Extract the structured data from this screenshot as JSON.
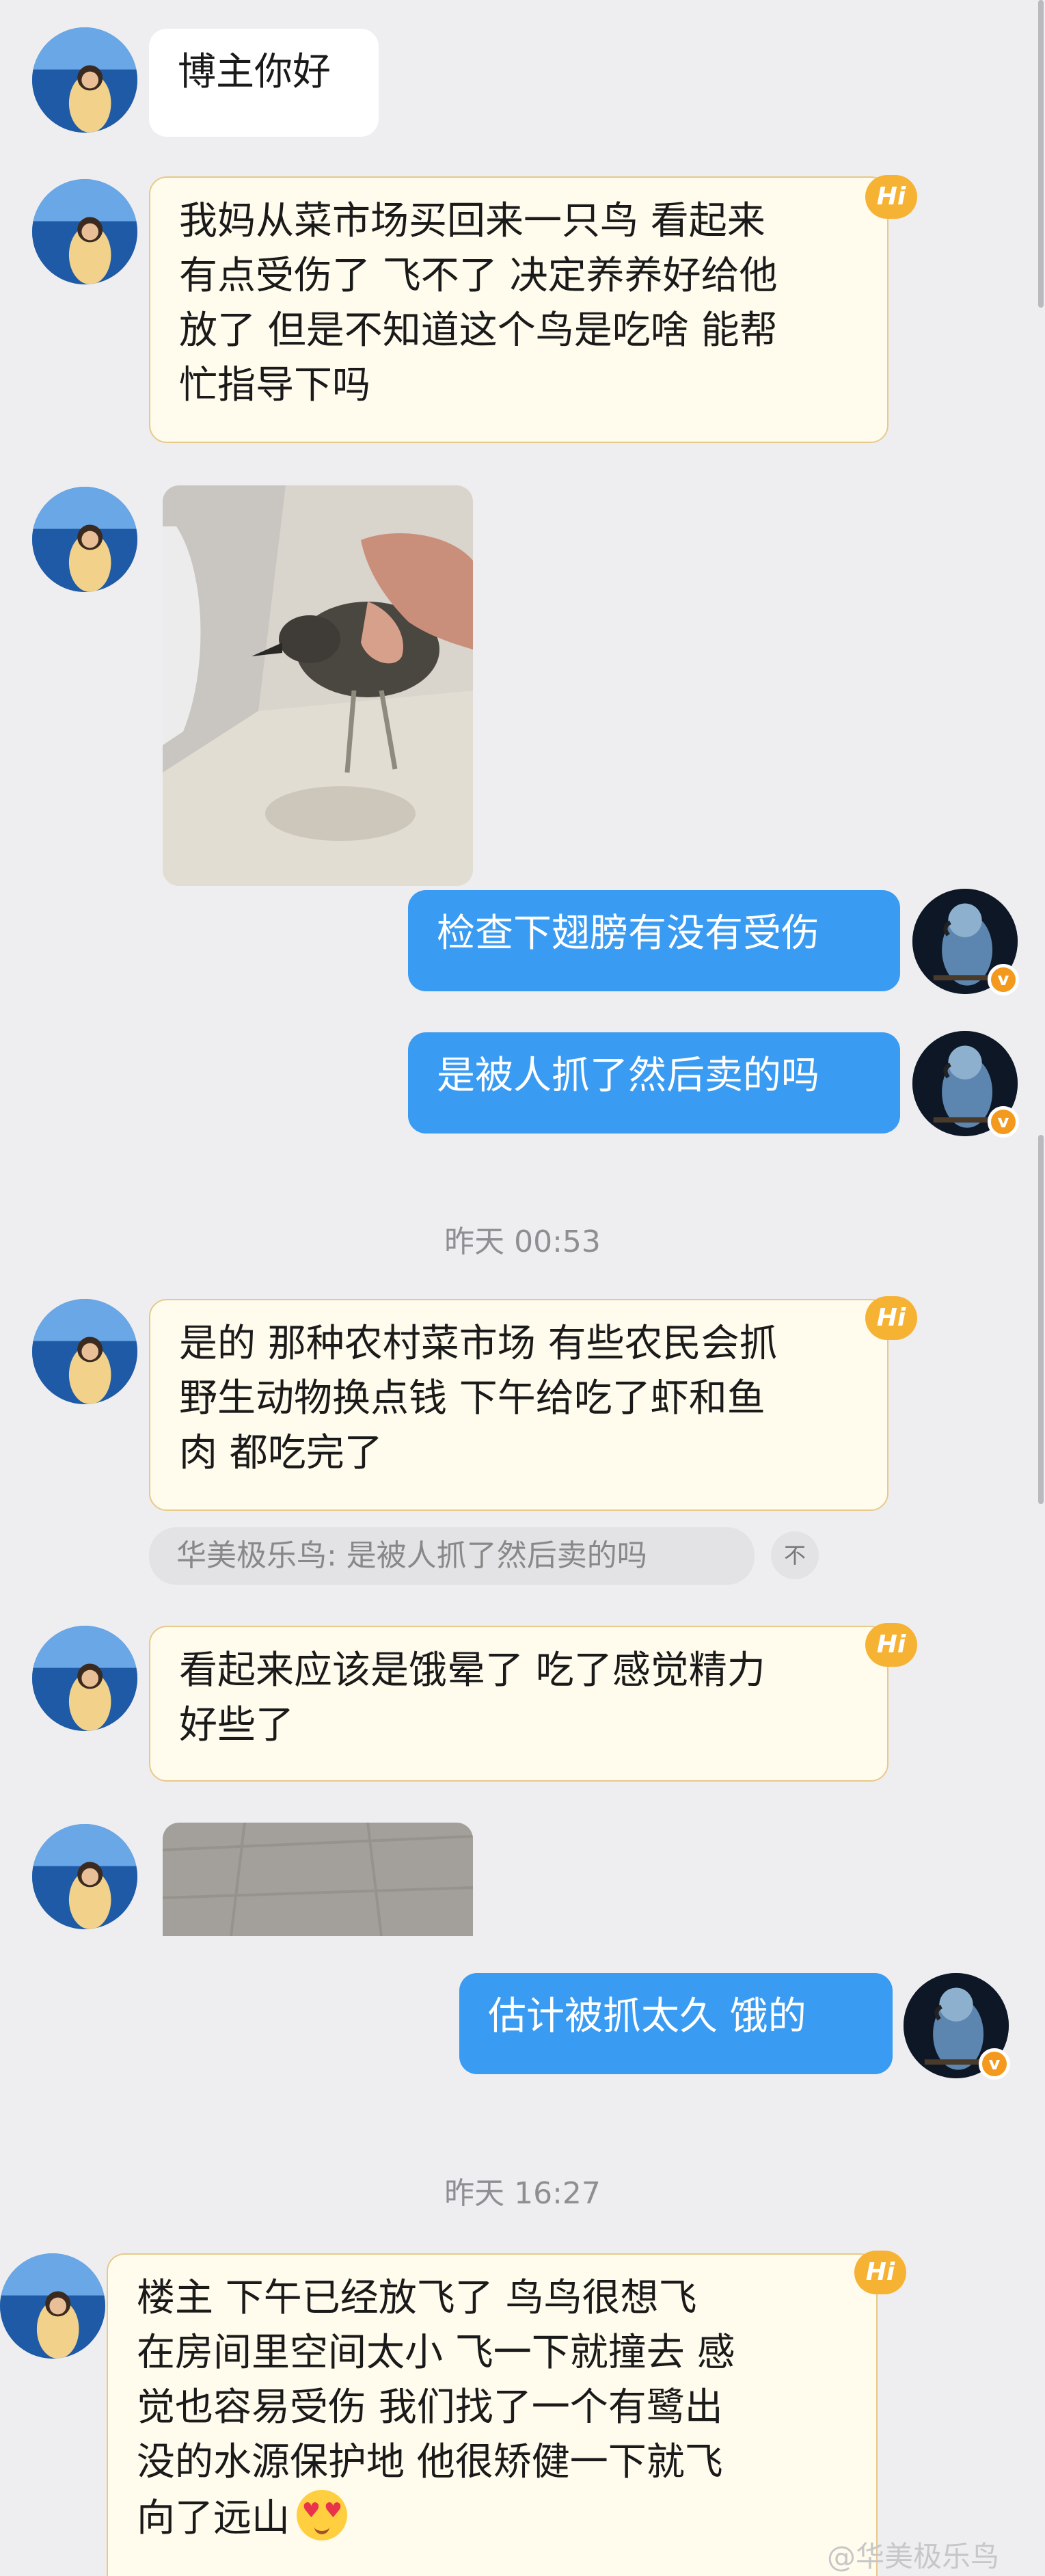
{
  "messages": {
    "m1": "博主你好",
    "m2": [
      "我妈从菜市场买回来一只鸟 看起来",
      "有点受伤了 飞不了 决定养养好给他",
      "放了 但是不知道这个鸟是吃啥 能帮",
      "忙指导下吗"
    ],
    "m3": "检查下翅膀有没有受伤",
    "m4": "是被人抓了然后卖的吗",
    "m5": [
      "是的 那种农村菜市场 有些农民会抓",
      "野生动物换点钱 下午给吃了虾和鱼",
      "肉 都吃完了"
    ],
    "m6": [
      "看起来应该是饿晕了 吃了感觉精力",
      "好些了"
    ],
    "m7": "估计被抓太久 饿的",
    "m8": [
      "楼主 下午已经放飞了 鸟鸟很想飞",
      "在房间里空间太小 飞一下就撞去 感",
      "觉也容易受伤 我们找了一个有鹭出",
      "没的水源保护地 他很矫健一下就飞",
      "向了远山"
    ]
  },
  "timestamps": {
    "t1": "昨天 00:53",
    "t2": "昨天 16:27"
  },
  "quote": {
    "text": "华美极乐鸟: 是被人抓了然后卖的吗",
    "button": "不"
  },
  "badges": {
    "hi": "Hi",
    "verified": "v"
  },
  "watermark": "@华美极乐鸟",
  "colors": {
    "background": "#eeeef0",
    "sent_bubble": "#3a9bf2",
    "received_hi_bubble": "#fffbed",
    "hi_badge": "#f6b233",
    "verified_badge": "#f39a1e"
  }
}
